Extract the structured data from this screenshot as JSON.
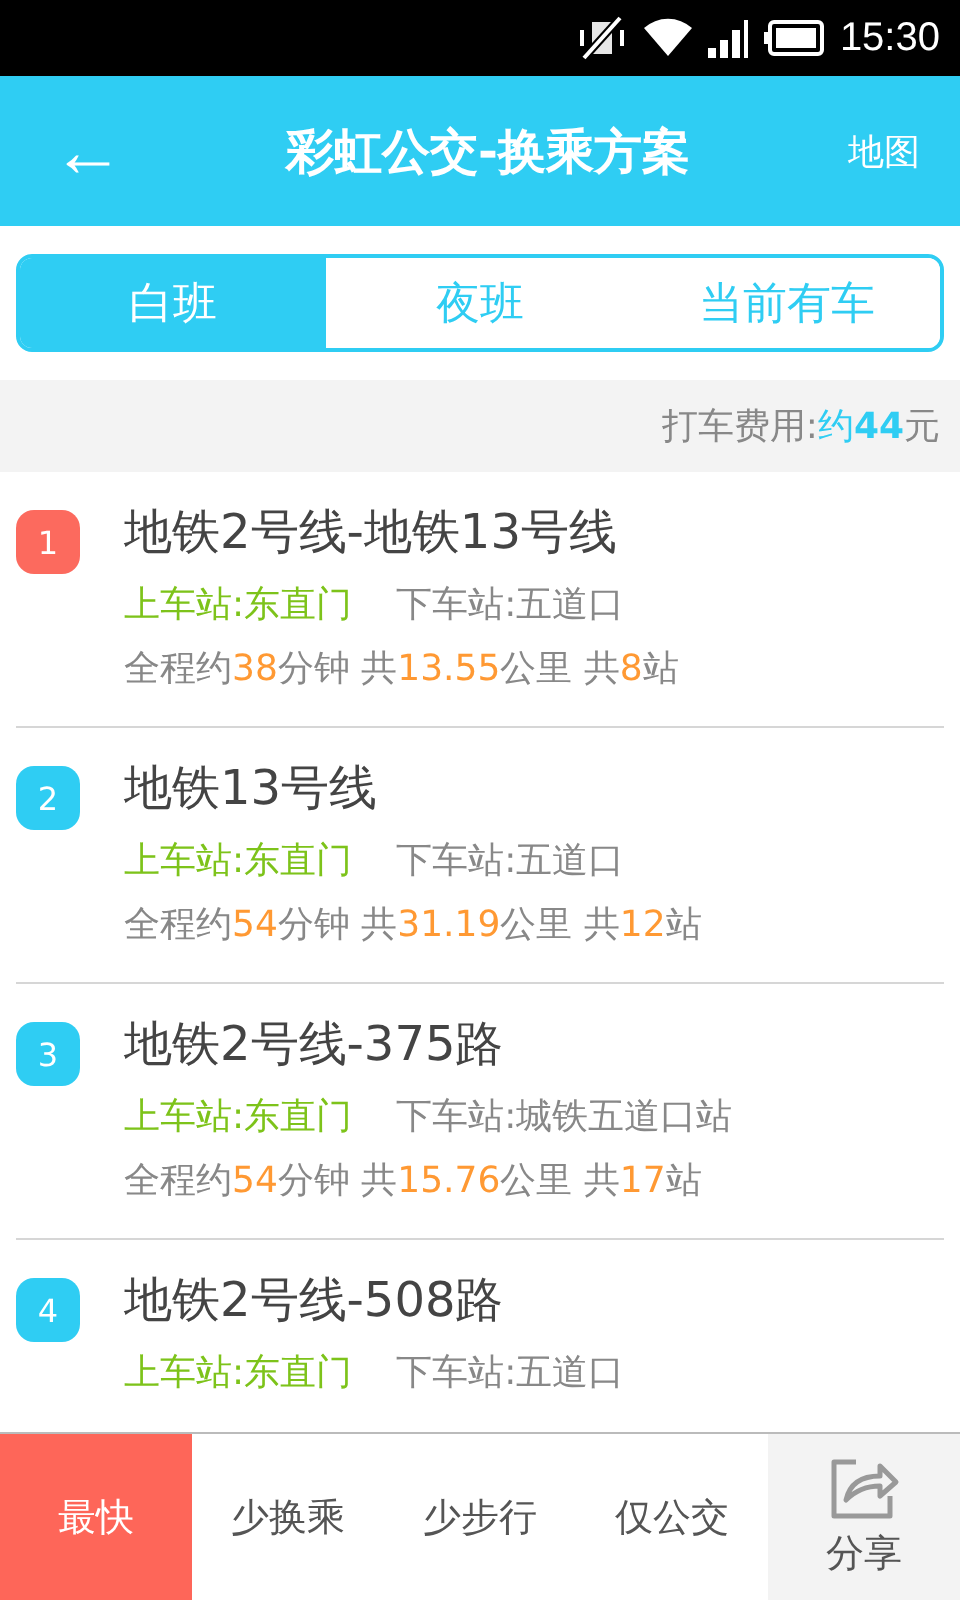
{
  "status_bar": {
    "time": "15:30"
  },
  "header": {
    "back": "←",
    "title": "彩虹公交-换乘方案",
    "action": "地图"
  },
  "tabs": [
    {
      "label": "白班",
      "selected": true
    },
    {
      "label": "夜班",
      "selected": false
    },
    {
      "label": "当前有车",
      "selected": false
    }
  ],
  "fare": [
    {
      "kind": "text",
      "text": "打车费用:"
    },
    {
      "kind": "accent",
      "text": "约"
    },
    {
      "kind": "accent_bold",
      "text": "44"
    },
    {
      "kind": "text",
      "text": "元"
    }
  ],
  "routes": [
    {
      "index": "1",
      "color": "#fc6a5e",
      "title": "地铁2号线-地铁13号线",
      "board": "上车站:东直门",
      "alight": "下车站:五道口",
      "stats": [
        {
          "kind": "text",
          "text": "全程约"
        },
        {
          "kind": "num",
          "text": "38"
        },
        {
          "kind": "text",
          "text": "分钟 共"
        },
        {
          "kind": "num",
          "text": "13.55"
        },
        {
          "kind": "text",
          "text": "公里 共"
        },
        {
          "kind": "num",
          "text": "8"
        },
        {
          "kind": "text",
          "text": "站"
        }
      ]
    },
    {
      "index": "2",
      "color": "#2fcdf3",
      "title": "地铁13号线",
      "board": "上车站:东直门",
      "alight": "下车站:五道口",
      "stats": [
        {
          "kind": "text",
          "text": "全程约"
        },
        {
          "kind": "num",
          "text": "54"
        },
        {
          "kind": "text",
          "text": "分钟 共"
        },
        {
          "kind": "num",
          "text": "31.19"
        },
        {
          "kind": "text",
          "text": "公里 共"
        },
        {
          "kind": "num",
          "text": "12"
        },
        {
          "kind": "text",
          "text": "站"
        }
      ]
    },
    {
      "index": "3",
      "color": "#2fcdf3",
      "title": "地铁2号线-375路",
      "board": "上车站:东直门",
      "alight": "下车站:城铁五道口站",
      "stats": [
        {
          "kind": "text",
          "text": "全程约"
        },
        {
          "kind": "num",
          "text": "54"
        },
        {
          "kind": "text",
          "text": "分钟 共"
        },
        {
          "kind": "num",
          "text": "15.76"
        },
        {
          "kind": "text",
          "text": "公里 共"
        },
        {
          "kind": "num",
          "text": "17"
        },
        {
          "kind": "text",
          "text": "站"
        }
      ]
    },
    {
      "index": "4",
      "color": "#2fcdf3",
      "title": "地铁2号线-508路",
      "board": "上车站:东直门",
      "alight": "下车站:五道口"
    }
  ],
  "sort_options": [
    {
      "label": "最快",
      "selected": true
    },
    {
      "label": "少换乘",
      "selected": false
    },
    {
      "label": "少步行",
      "selected": false
    },
    {
      "label": "仅公交",
      "selected": false
    }
  ],
  "share": {
    "label": "分享"
  }
}
